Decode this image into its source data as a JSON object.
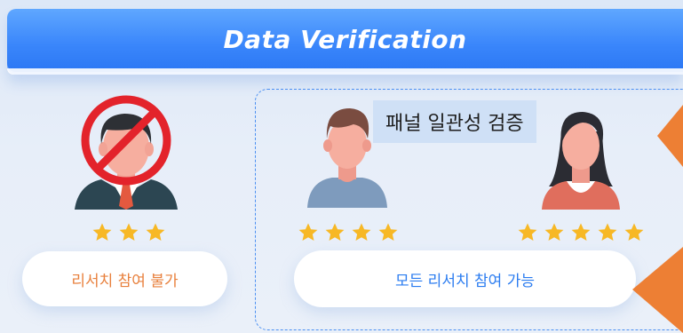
{
  "header": {
    "title": "Data Verification"
  },
  "panel_label": "패널 일관성 검증",
  "left": {
    "rating": 3,
    "pill_label": "리서치 참여 불가",
    "icons": [
      "excluded-man-avatar-icon",
      "prohibited-sign-icon"
    ]
  },
  "right": {
    "pill_label": "모든 리서치 참여 가능",
    "panelists": [
      {
        "icon": "man-avatar-icon",
        "rating": 4
      },
      {
        "icon": "woman-avatar-icon",
        "rating": 5
      }
    ]
  },
  "colors": {
    "header_blue": "#3a86fb",
    "accent_orange": "#ed7f34",
    "star_gold": "#f7b825",
    "prohibit_red": "#e3232b",
    "dashed_border": "#4a8ff2",
    "link_blue": "#2b7cf0"
  }
}
